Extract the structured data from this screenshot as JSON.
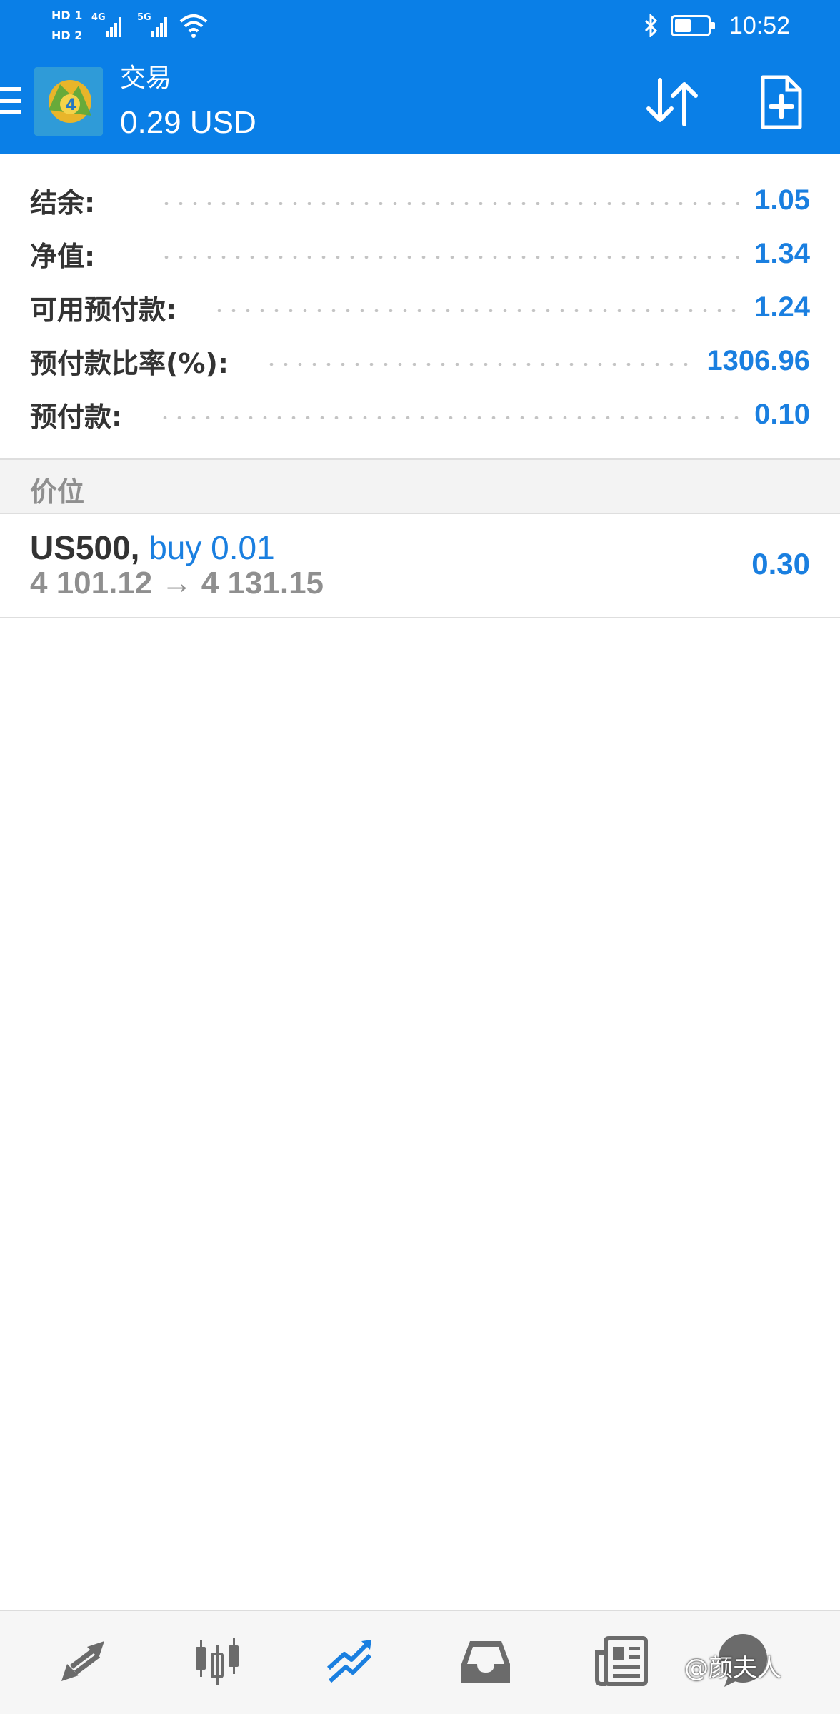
{
  "status_bar": {
    "sim1": "HD 1",
    "sim2": "HD 2",
    "net1": "4G",
    "net2": "5G",
    "time": "10:52"
  },
  "header": {
    "title": "交易",
    "balance": "0.29 USD",
    "icons": [
      "menu-icon",
      "app-logo",
      "sort-icon",
      "new-order-icon"
    ]
  },
  "summary": [
    {
      "label": "结余:",
      "value": "1.05"
    },
    {
      "label": "净值:",
      "value": "1.34"
    },
    {
      "label": "可用预付款:",
      "value": "1.24"
    },
    {
      "label": "预付款比率(%):",
      "value": "1306.96"
    },
    {
      "label": "预付款:",
      "value": "0.10"
    }
  ],
  "positions_section": {
    "title": "价位",
    "items": [
      {
        "symbol": "US500,",
        "side": "buy 0.01",
        "open_price": "4 101.12",
        "arrow": "→",
        "current_price": "4 131.15",
        "profit": "0.30"
      }
    ]
  },
  "bottom_nav": {
    "items": [
      "quotes-icon",
      "chart-icon",
      "trade-icon",
      "history-icon",
      "news-icon",
      "chat-icon"
    ],
    "active": "trade-icon",
    "active_color": "#1a7fe0",
    "inactive_color": "#6b6b6b"
  },
  "watermark": "@颜夫人",
  "colors": {
    "appbar": "#0a7fe7",
    "value_blue": "#1a7fe0",
    "label_dark": "#333333",
    "muted_gray": "#8f8f8f"
  }
}
